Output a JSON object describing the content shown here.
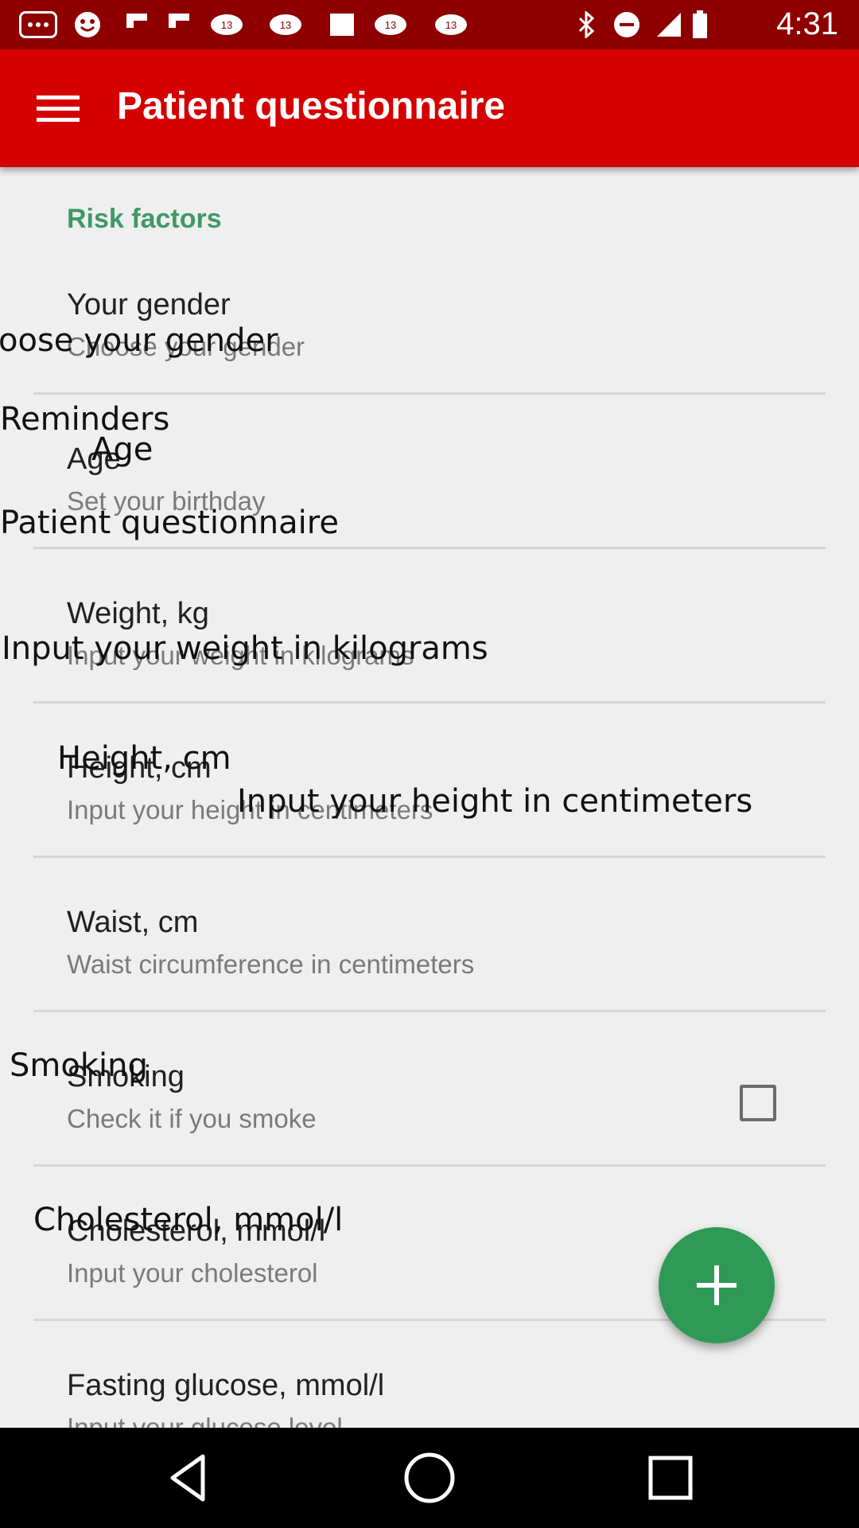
{
  "status_bar": {
    "time": "4:31",
    "icons": [
      "chat-icon",
      "emoji-icon",
      "flipboard-icon",
      "flipboard-icon",
      "news-icon",
      "blank-icon",
      "news-icon",
      "news-icon",
      "bluetooth-icon",
      "do-not-disturb-icon",
      "signal-icon",
      "battery-icon"
    ]
  },
  "app_bar": {
    "title": "Patient questionnaire",
    "menu_icon": "hamburger-menu-icon"
  },
  "section": {
    "header": "Risk factors"
  },
  "items": [
    {
      "title": "Your gender",
      "summary": "Choose your gender"
    },
    {
      "title": "Age",
      "summary": "Set your birthday"
    },
    {
      "title": "Weight, kg",
      "summary": "Input your weight in kilograms"
    },
    {
      "title": "Height, cm",
      "summary": "Input your height in centimeters"
    },
    {
      "title": "Waist, cm",
      "summary": "Waist circumference in centimeters"
    },
    {
      "title": "Smoking",
      "summary": "Check it if you smoke",
      "checked": false
    },
    {
      "title": "Cholesterol, mmol/l",
      "summary": "Input your cholesterol"
    },
    {
      "title": "Fasting glucose, mmol/l",
      "summary": "Input your glucose level"
    }
  ],
  "overlay_labels": {
    "gender": "oose your gender",
    "reminders": "Reminders",
    "age": "Age",
    "questionnaire": "Patient questionnaire",
    "weight": "Input your weight in kilograms",
    "height": "Height, cm",
    "height_summary": "Input your height in centimeters",
    "smoking": "Smoking",
    "cholesterol": "Cholesterol, mmol/l"
  },
  "fab": {
    "icon": "plus-icon"
  },
  "nav_bar": {
    "icons": [
      "back-icon",
      "home-icon",
      "recents-icon"
    ]
  },
  "colors": {
    "status_bar": "#8e0000",
    "app_bar": "#d50000",
    "accent": "#3f9a66",
    "fab": "#2e9a55",
    "background": "#efefef"
  }
}
